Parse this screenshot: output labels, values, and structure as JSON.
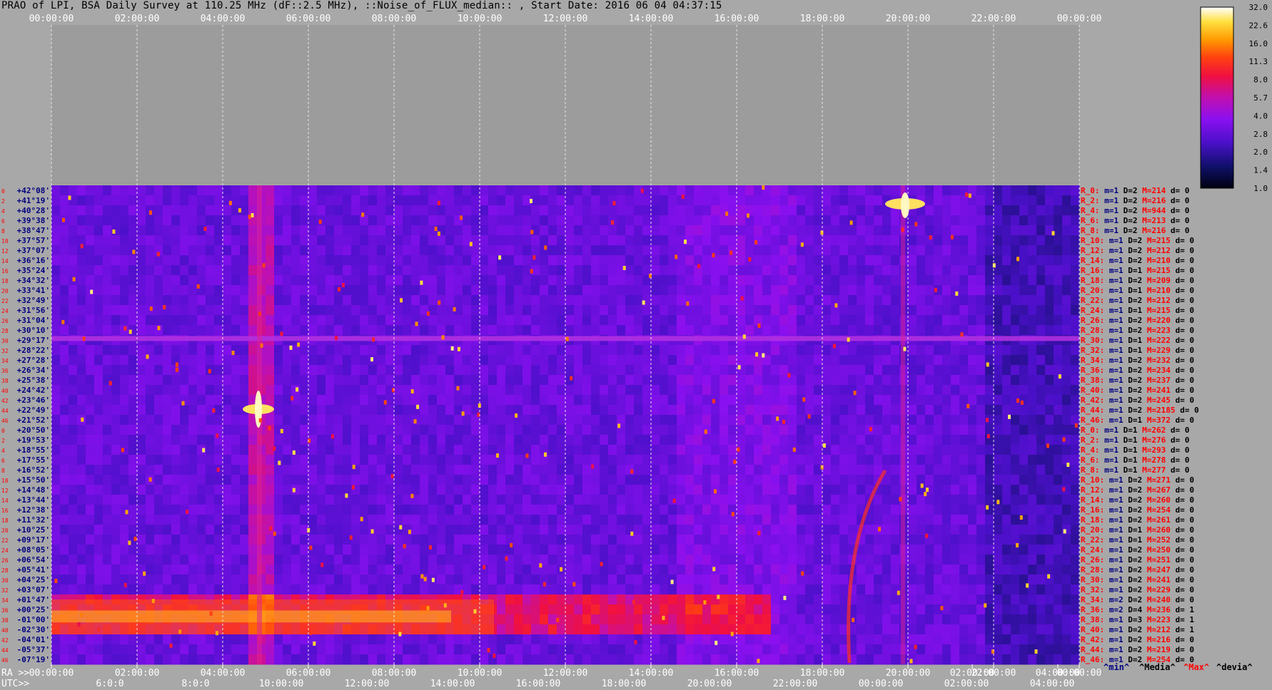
{
  "title": "PRAO of LPI, BSA Daily Survey at 110.25 MHz (dF::2.5 MHz), ::Noise_of_FLUX_median:: , Start Date: 2016 06 04 04:37:15",
  "chart_data": {
    "type": "heatmap",
    "top_axis_ticks": [
      "00:00:00",
      "02:00:00",
      "04:00:00",
      "06:00:00",
      "08:00:00",
      "10:00:00",
      "12:00:00",
      "14:00:00",
      "16:00:00",
      "18:00:00",
      "20:00:00",
      "22:00:00",
      "00:00:00"
    ],
    "ra_axis": {
      "label": "RA >>",
      "ticks": [
        "00:00:00",
        "02:00:00",
        "04:00:00",
        "06:00:00",
        "08:00:00",
        "10:00:00",
        "12:00:00",
        "14:00:00",
        "16:00:00",
        "18:00:00",
        "20:00:00",
        "02:00:00",
        "22:00:00",
        "04:00:00",
        "00:00:00"
      ]
    },
    "utc_axis": {
      "label": "UTC>>",
      "ticks": [
        "6:0:0",
        "8:0:0",
        "10:00:00",
        "12:00:00",
        "14:00:00",
        "16:00:00",
        "18:00:00",
        "20:00:00",
        "22:00:00",
        "00:00:00",
        "02:00:00",
        "04:00:00"
      ]
    },
    "declinations": [
      "+42°08'",
      "+41°19'",
      "+40°28'",
      "+39°38'",
      "+38°47'",
      "+37°57'",
      "+37°07'",
      "+36°16'",
      "+35°24'",
      "+34°32'",
      "+33°41'",
      "+32°49'",
      "+31°56'",
      "+31°04'",
      "+30°10'",
      "+29°17'",
      "+28°22'",
      "+27°28'",
      "+26°34'",
      "+25°38'",
      "+24°42'",
      "+23°46'",
      "+22°49'",
      "+21°52'",
      "+20°50'",
      "+19°53'",
      "+18°55'",
      "+17°55'",
      "+16°52'",
      "+15°50'",
      "+14°48'",
      "+13°44'",
      "+12°38'",
      "+11°32'",
      "+10°25'",
      "+09°17'",
      "+08°05'",
      "+06°54'",
      "+05°41'",
      "+04°25'",
      "+03°07'",
      "+01°47'",
      "+00°25'",
      "-01°00'",
      "-02°30'",
      "-04°01'",
      "-05°37'",
      "-07°19'"
    ],
    "rows": [
      {
        "r": "R_0:",
        "m": "m=1",
        "D": "D=2",
        "M": "M=214",
        "d": "d= 0"
      },
      {
        "r": "R_2:",
        "m": "m=1",
        "D": "D=2",
        "M": "M=216",
        "d": "d= 0"
      },
      {
        "r": "R_4:",
        "m": "m=1",
        "D": "D=2",
        "M": "M=944",
        "d": "d= 0"
      },
      {
        "r": "R_6:",
        "m": "m=1",
        "D": "D=2",
        "M": "M=213",
        "d": "d= 0"
      },
      {
        "r": "R_8:",
        "m": "m=1",
        "D": "D=2",
        "M": "M=216",
        "d": "d= 0"
      },
      {
        "r": "R_10:",
        "m": "m=1",
        "D": "D=2",
        "M": "M=215",
        "d": "d= 0"
      },
      {
        "r": "R_12:",
        "m": "m=1",
        "D": "D=2",
        "M": "M=212",
        "d": "d= 0"
      },
      {
        "r": "R_14:",
        "m": "m=1",
        "D": "D=2",
        "M": "M=210",
        "d": "d= 0"
      },
      {
        "r": "R_16:",
        "m": "m=1",
        "D": "D=1",
        "M": "M=215",
        "d": "d= 0"
      },
      {
        "r": "R_18:",
        "m": "m=1",
        "D": "D=2",
        "M": "M=209",
        "d": "d= 0"
      },
      {
        "r": "R_20:",
        "m": "m=1",
        "D": "D=1",
        "M": "M=210",
        "d": "d= 0"
      },
      {
        "r": "R_22:",
        "m": "m=1",
        "D": "D=2",
        "M": "M=212",
        "d": "d= 0"
      },
      {
        "r": "R_24:",
        "m": "m=1",
        "D": "D=1",
        "M": "M=215",
        "d": "d= 0"
      },
      {
        "r": "R_26:",
        "m": "m=1",
        "D": "D=2",
        "M": "M=220",
        "d": "d= 0"
      },
      {
        "r": "R_28:",
        "m": "m=1",
        "D": "D=2",
        "M": "M=223",
        "d": "d= 0"
      },
      {
        "r": "R_30:",
        "m": "m=1",
        "D": "D=1",
        "M": "M=222",
        "d": "d= 0"
      },
      {
        "r": "R_32:",
        "m": "m=1",
        "D": "D=1",
        "M": "M=229",
        "d": "d= 0"
      },
      {
        "r": "R_34:",
        "m": "m=1",
        "D": "D=2",
        "M": "M=232",
        "d": "d= 0"
      },
      {
        "r": "R_36:",
        "m": "m=1",
        "D": "D=2",
        "M": "M=234",
        "d": "d= 0"
      },
      {
        "r": "R_38:",
        "m": "m=1",
        "D": "D=2",
        "M": "M=237",
        "d": "d= 0"
      },
      {
        "r": "R_40:",
        "m": "m=1",
        "D": "D=2",
        "M": "M=241",
        "d": "d= 0"
      },
      {
        "r": "R_42:",
        "m": "m=1",
        "D": "D=2",
        "M": "M=245",
        "d": "d= 0"
      },
      {
        "r": "R_44:",
        "m": "m=1",
        "D": "D=2",
        "M": "M=2185",
        "d": "d= 0"
      },
      {
        "r": "R_46:",
        "m": "m=1",
        "D": "D=1",
        "M": "M=372",
        "d": "d= 0"
      },
      {
        "r": "R_0:",
        "m": "m=1",
        "D": "D=1",
        "M": "M=262",
        "d": "d= 0"
      },
      {
        "r": "R_2:",
        "m": "m=1",
        "D": "D=1",
        "M": "M=276",
        "d": "d= 0"
      },
      {
        "r": "R_4:",
        "m": "m=1",
        "D": "D=1",
        "M": "M=293",
        "d": "d= 0"
      },
      {
        "r": "R_6:",
        "m": "m=1",
        "D": "D=1",
        "M": "M=278",
        "d": "d= 0"
      },
      {
        "r": "R_8:",
        "m": "m=1",
        "D": "D=1",
        "M": "M=277",
        "d": "d= 0"
      },
      {
        "r": "R_10:",
        "m": "m=1",
        "D": "D=2",
        "M": "M=271",
        "d": "d= 0"
      },
      {
        "r": "R_12:",
        "m": "m=1",
        "D": "D=2",
        "M": "M=267",
        "d": "d= 0"
      },
      {
        "r": "R_14:",
        "m": "m=1",
        "D": "D=2",
        "M": "M=260",
        "d": "d= 0"
      },
      {
        "r": "R_16:",
        "m": "m=1",
        "D": "D=2",
        "M": "M=254",
        "d": "d= 0"
      },
      {
        "r": "R_18:",
        "m": "m=1",
        "D": "D=2",
        "M": "M=261",
        "d": "d= 0"
      },
      {
        "r": "R_20:",
        "m": "m=1",
        "D": "D=1",
        "M": "M=260",
        "d": "d= 0"
      },
      {
        "r": "R_22:",
        "m": "m=1",
        "D": "D=1",
        "M": "M=252",
        "d": "d= 0"
      },
      {
        "r": "R_24:",
        "m": "m=1",
        "D": "D=2",
        "M": "M=250",
        "d": "d= 0"
      },
      {
        "r": "R_26:",
        "m": "m=1",
        "D": "D=2",
        "M": "M=251",
        "d": "d= 0"
      },
      {
        "r": "R_28:",
        "m": "m=1",
        "D": "D=2",
        "M": "M=247",
        "d": "d= 0"
      },
      {
        "r": "R_30:",
        "m": "m=1",
        "D": "D=2",
        "M": "M=241",
        "d": "d= 0"
      },
      {
        "r": "R_32:",
        "m": "m=1",
        "D": "D=2",
        "M": "M=229",
        "d": "d= 0"
      },
      {
        "r": "R_34:",
        "m": "m=2",
        "D": "D=2",
        "M": "M=240",
        "d": "d= 0"
      },
      {
        "r": "R_36:",
        "m": "m=2",
        "D": "D=4",
        "M": "M=236",
        "d": "d= 1"
      },
      {
        "r": "R_38:",
        "m": "m=1",
        "D": "D=3",
        "M": "M=223",
        "d": "d= 1"
      },
      {
        "r": "R_40:",
        "m": "m=1",
        "D": "D=2",
        "M": "M=212",
        "d": "d= 1"
      },
      {
        "r": "R_42:",
        "m": "m=1",
        "D": "D=2",
        "M": "M=216",
        "d": "d= 0"
      },
      {
        "r": "R_44:",
        "m": "m=1",
        "D": "D=2",
        "M": "M=219",
        "d": "d= 0"
      },
      {
        "r": "R_46:",
        "m": "m=1",
        "D": "D=2",
        "M": "M=254",
        "d": "d= 0"
      }
    ],
    "left_row_numbers": [
      "0",
      "2",
      "4",
      "6",
      "8",
      "10",
      "12",
      "14",
      "16",
      "18",
      "20",
      "22",
      "24",
      "26",
      "28",
      "30",
      "32",
      "34",
      "36",
      "38",
      "40",
      "42",
      "44",
      "46",
      "0",
      "2",
      "4",
      "6",
      "8",
      "10",
      "12",
      "14",
      "16",
      "18",
      "20",
      "22",
      "24",
      "26",
      "28",
      "30",
      "32",
      "34",
      "36",
      "38",
      "40",
      "42",
      "44",
      "46"
    ],
    "colorbar_ticks": [
      "32.0",
      "22.6",
      "16.0",
      "11.3",
      "8.0",
      "5.7",
      "4.0",
      "2.8",
      "2.0",
      "1.4",
      "1.0"
    ],
    "legend": [
      "^min^",
      "^Media^",
      "^Max^",
      "^devia^"
    ],
    "colors": {
      "min": "#000080",
      "media": "#000000",
      "max": "#ff0000",
      "devia": "#000000",
      "row_label": "#ff0000",
      "dec_label": "#000080",
      "background": "#a8a8a8"
    }
  }
}
